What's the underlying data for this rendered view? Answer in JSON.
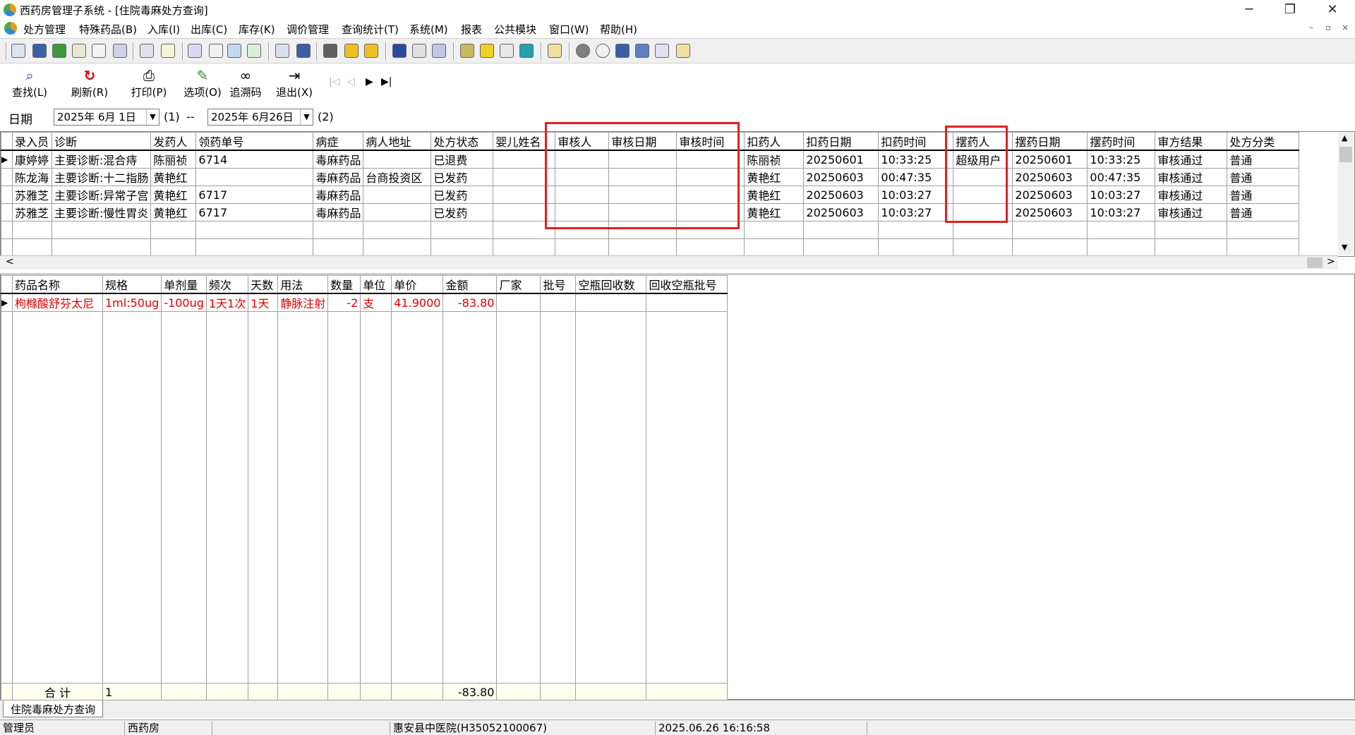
{
  "window": {
    "title": "西药房管理子系统 - [住院毒麻处方查询]",
    "min_glyph": "─",
    "max_glyph": "❐",
    "close_glyph": "✕"
  },
  "menu": {
    "items": [
      "处方管理",
      "特殊药品(B)",
      "入库(I)",
      "出库(C)",
      "库存(K)",
      "调价管理",
      "查询统计(T)",
      "系统(M)",
      "报表",
      "公共模块",
      "窗口(W)",
      "帮助(H)"
    ],
    "mdi_min": "–",
    "mdi_restore": "▫",
    "mdi_close": "×"
  },
  "toolbar": {
    "buttons": [
      "查找(L)",
      "刷新(R)",
      "打印(P)",
      "选项(O)",
      "追溯码",
      "退出(X)"
    ],
    "button_icons": [
      "magnifier-icon",
      "refresh-icon",
      "printer-icon",
      "options-icon",
      "binoculars-icon",
      "exit-icon"
    ],
    "nav": [
      "|◁",
      "◁",
      "▶",
      "▶|"
    ]
  },
  "filter": {
    "date_label": "日期",
    "start_date": "2025年 6月 1日",
    "marker1": "(1)",
    "separator": "--",
    "end_date": "2025年 6月26日",
    "marker2": "(2)"
  },
  "prescriptions": {
    "columns": [
      "录入员",
      "诊断",
      "发药人",
      "领药单号",
      "病症",
      "病人地址",
      "处方状态",
      "婴儿姓名",
      "审核人",
      "审核日期",
      "审核时间",
      "扣药人",
      "扣药日期",
      "扣药时间",
      "摆药人",
      "摆药日期",
      "摆药时间",
      "审方结果",
      "处方分类"
    ],
    "rows": [
      [
        "康婷婷",
        "主要诊断:混合痔",
        "陈丽祯",
        "6714",
        "毒麻药品",
        "",
        "已退费",
        "",
        "",
        "",
        "",
        "陈丽祯",
        "20250601",
        "10:33:25",
        "超级用户",
        "20250601",
        "10:33:25",
        "审核通过",
        "普通"
      ],
      [
        "陈龙海",
        "主要诊断:十二指肠",
        "黄艳红",
        "",
        "毒麻药品",
        "台商投资区",
        "已发药",
        "",
        "",
        "",
        "",
        "黄艳红",
        "20250603",
        "00:47:35",
        "",
        "20250603",
        "00:47:35",
        "审核通过",
        "普通"
      ],
      [
        "苏雅芝",
        "主要诊断:异常子宫",
        "黄艳红",
        "6717",
        "毒麻药品",
        "",
        "已发药",
        "",
        "",
        "",
        "",
        "黄艳红",
        "20250603",
        "10:03:27",
        "",
        "20250603",
        "10:03:27",
        "审核通过",
        "普通"
      ],
      [
        "苏雅芝",
        "主要诊断:慢性胃炎",
        "黄艳红",
        "6717",
        "毒麻药品",
        "",
        "已发药",
        "",
        "",
        "",
        "",
        "黄艳红",
        "20250603",
        "10:03:27",
        "",
        "20250603",
        "10:03:27",
        "审核通过",
        "普通"
      ]
    ],
    "empty_rows": 2,
    "selected_row": 0,
    "indicator_glyph": "▶"
  },
  "scroll": {
    "up": "▲",
    "down": "▼",
    "left": "<",
    "right": ">"
  },
  "drugs": {
    "columns": [
      "药品名称",
      "规格",
      "单剂量",
      "频次",
      "天数",
      "用法",
      "数量",
      "单位",
      "单价",
      "金额",
      "厂家",
      "批号",
      "空瓶回收数",
      "回收空瓶批号"
    ],
    "rows": [
      [
        "枸橼酸舒芬太尼",
        "1ml:50ug",
        "-100ug",
        "1天1次",
        "1天",
        "静脉注射",
        "-2",
        "支",
        "41.9000",
        "-83.80",
        "",
        "",
        "",
        ""
      ]
    ],
    "summary": [
      "合  计",
      "1",
      "",
      "",
      "",
      "",
      "",
      "",
      "",
      "-83.80",
      "",
      "",
      "",
      ""
    ],
    "text_color": "#e00000"
  },
  "tabs": {
    "active": "住院毒麻处方查询"
  },
  "status": {
    "user": "管理员",
    "department": "西药房",
    "hospital": "惠安县中医院(H35052100067)",
    "datetime": "2025.06.26 16:16:58"
  },
  "highlight_color": "#e02020"
}
